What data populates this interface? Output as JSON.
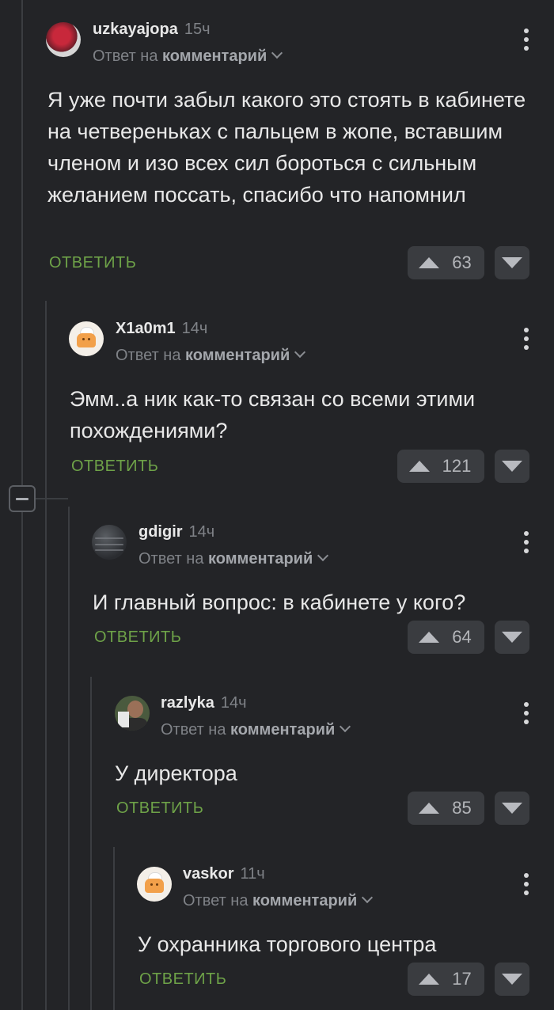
{
  "comments": [
    {
      "username": "uzkayajopa",
      "time": "15ч",
      "reply_prefix": "Ответ на",
      "reply_target": "комментарий",
      "text": "Я уже почти забыл какого это стоять в кабинете на четвереньках с пальцем в жопе, вставшим членом и изо всех сил бороться с сильным желанием поссать, спасибо что напомнил",
      "reply_label": "ОТВЕТИТЬ",
      "score": "63",
      "avatar": "avatar-red-figure"
    },
    {
      "username": "X1a0m1",
      "time": "14ч",
      "reply_prefix": "Ответ на",
      "reply_target": "комментарий",
      "text": "Эмм..а ник как-то связан со всеми этими похождениями?",
      "reply_label": "ОТВЕТИТЬ",
      "score": "121",
      "avatar": "avatar-bread-cat"
    },
    {
      "username": "gdigir",
      "time": "14ч",
      "reply_prefix": "Ответ на",
      "reply_target": "комментарий",
      "text": "И главный вопрос: в кабинете у кого?",
      "reply_label": "ОТВЕТИТЬ",
      "score": "64",
      "avatar": "avatar-dark-water"
    },
    {
      "username": "razlyka",
      "time": "14ч",
      "reply_prefix": "Ответ на",
      "reply_target": "комментарий",
      "text": "У директора",
      "reply_label": "ОТВЕТИТЬ",
      "score": "85",
      "avatar": "avatar-photo-person"
    },
    {
      "username": "vaskor",
      "time": "11ч",
      "reply_prefix": "Ответ на",
      "reply_target": "комментарий",
      "text": "У охранника торгового центра",
      "reply_label": "ОТВЕТИТЬ",
      "score": "17",
      "avatar": "avatar-bread-cat"
    }
  ],
  "icons": {
    "more": "more-vertical-icon",
    "upvote": "upvote-arrow-icon",
    "downvote": "downvote-arrow-icon",
    "chevron": "chevron-down-icon",
    "collapse": "collapse-minus-icon"
  },
  "colors": {
    "background": "#232427",
    "reply_green": "#6ea248",
    "thread_line": "#3b3d41"
  }
}
